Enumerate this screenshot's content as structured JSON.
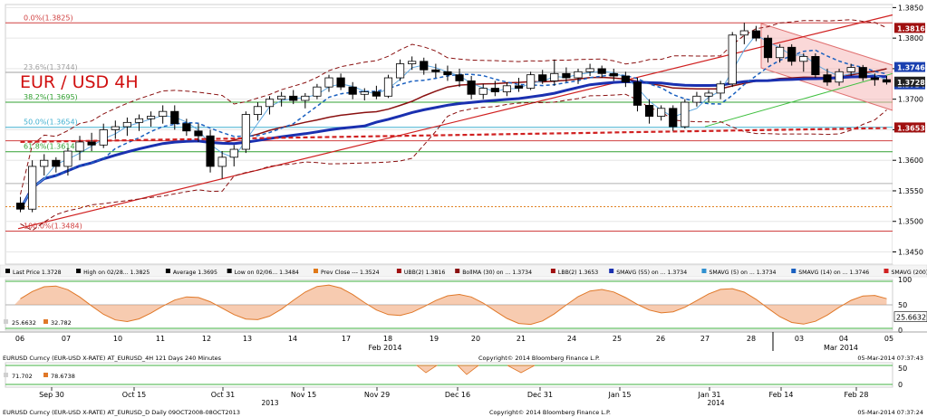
{
  "chart_data": {
    "type": "candlestick",
    "title": "EUR / USD 4H",
    "fib_levels": [
      {
        "label": "0.0%(1.3825)",
        "value": 1.3825,
        "color": "#d04040"
      },
      {
        "label": "23.6%(1.3744)",
        "value": 1.3744,
        "color": "#a0a0a0"
      },
      {
        "label": "38.2%(1.3695)",
        "value": 1.3695,
        "color": "#30a030"
      },
      {
        "label": "50.0%(1.3654)",
        "value": 1.3654,
        "color": "#40b0d0"
      },
      {
        "label": "61.8%(1.3614)",
        "value": 1.3614,
        "color": "#30a030"
      },
      {
        "label": "100.0%(1.3484)",
        "value": 1.3484,
        "color": "#d04040"
      }
    ],
    "y_ticks": [
      "1.3850",
      "1.3800",
      "1.3750",
      "1.3700",
      "1.3650",
      "1.3600",
      "1.3550",
      "1.3500",
      "1.3450"
    ],
    "ylim": [
      1.343,
      1.3855
    ],
    "price_tags": [
      {
        "label": "1.3816",
        "value": 1.3816,
        "bg": "#a01010"
      },
      {
        "label": "1.3746",
        "value": 1.3746,
        "bg": "#1a40b0"
      },
      {
        "label": "1.3734",
        "value": 1.3734,
        "bg": "#1a40b0"
      },
      {
        "label": "1.3728",
        "value": 1.3728,
        "bg": "#222222"
      },
      {
        "label": "1.3653",
        "value": 1.3653,
        "bg": "#a01010"
      }
    ],
    "x_day_labels": [
      "06",
      "07",
      "10",
      "11",
      "12",
      "13",
      "14",
      "17",
      "18",
      "19",
      "20",
      "21",
      "24",
      "25",
      "26",
      "27",
      "28",
      "03",
      "04",
      "05"
    ],
    "x_month_labels": [
      "Feb 2014",
      "Mar 2014"
    ],
    "candles": [
      [
        1.353,
        1.354,
        1.3515,
        1.352
      ],
      [
        1.352,
        1.36,
        1.3515,
        1.359
      ],
      [
        1.359,
        1.361,
        1.3575,
        1.36
      ],
      [
        1.36,
        1.3605,
        1.358,
        1.359
      ],
      [
        1.359,
        1.362,
        1.3575,
        1.3615
      ],
      [
        1.3615,
        1.364,
        1.36,
        1.363
      ],
      [
        1.363,
        1.3645,
        1.3615,
        1.3625
      ],
      [
        1.3625,
        1.366,
        1.362,
        1.365
      ],
      [
        1.365,
        1.3665,
        1.3635,
        1.3655
      ],
      [
        1.3655,
        1.367,
        1.364,
        1.3662
      ],
      [
        1.3662,
        1.3675,
        1.3648,
        1.3668
      ],
      [
        1.3668,
        1.368,
        1.3655,
        1.3672
      ],
      [
        1.3672,
        1.369,
        1.366,
        1.368
      ],
      [
        1.368,
        1.369,
        1.365,
        1.366
      ],
      [
        1.366,
        1.3668,
        1.364,
        1.3648
      ],
      [
        1.3648,
        1.366,
        1.363,
        1.364
      ],
      [
        1.364,
        1.365,
        1.358,
        1.359
      ],
      [
        1.359,
        1.3615,
        1.357,
        1.3605
      ],
      [
        1.3605,
        1.3625,
        1.359,
        1.3618
      ],
      [
        1.3618,
        1.368,
        1.3612,
        1.3675
      ],
      [
        1.3675,
        1.3695,
        1.3665,
        1.3688
      ],
      [
        1.3688,
        1.3705,
        1.3675,
        1.37
      ],
      [
        1.37,
        1.3712,
        1.3688,
        1.3705
      ],
      [
        1.3705,
        1.3715,
        1.3692,
        1.3698
      ],
      [
        1.3698,
        1.371,
        1.3685,
        1.3705
      ],
      [
        1.3705,
        1.3725,
        1.37,
        1.372
      ],
      [
        1.372,
        1.374,
        1.3712,
        1.3735
      ],
      [
        1.3735,
        1.3742,
        1.3715,
        1.372
      ],
      [
        1.372,
        1.3728,
        1.37,
        1.3708
      ],
      [
        1.3708,
        1.3718,
        1.3698,
        1.3712
      ],
      [
        1.3712,
        1.3722,
        1.37,
        1.3705
      ],
      [
        1.3705,
        1.374,
        1.3702,
        1.3735
      ],
      [
        1.3735,
        1.3765,
        1.373,
        1.3758
      ],
      [
        1.3758,
        1.377,
        1.3748,
        1.3762
      ],
      [
        1.3762,
        1.3768,
        1.374,
        1.3748
      ],
      [
        1.3748,
        1.3758,
        1.3735,
        1.3745
      ],
      [
        1.3745,
        1.3755,
        1.373,
        1.374
      ],
      [
        1.374,
        1.375,
        1.372,
        1.373
      ],
      [
        1.373,
        1.3738,
        1.37,
        1.3708
      ],
      [
        1.3708,
        1.3725,
        1.37,
        1.3718
      ],
      [
        1.3718,
        1.373,
        1.3705,
        1.3712
      ],
      [
        1.3712,
        1.3728,
        1.3705,
        1.3722
      ],
      [
        1.3722,
        1.3735,
        1.3712,
        1.3718
      ],
      [
        1.3718,
        1.3745,
        1.3715,
        1.374
      ],
      [
        1.374,
        1.3748,
        1.3725,
        1.373
      ],
      [
        1.373,
        1.3765,
        1.3722,
        1.3742
      ],
      [
        1.3742,
        1.3752,
        1.3728,
        1.3735
      ],
      [
        1.3735,
        1.375,
        1.3725,
        1.3745
      ],
      [
        1.3745,
        1.3758,
        1.3738,
        1.375
      ],
      [
        1.375,
        1.3755,
        1.3735,
        1.3742
      ],
      [
        1.3742,
        1.375,
        1.373,
        1.3738
      ],
      [
        1.3738,
        1.3745,
        1.372,
        1.3728
      ],
      [
        1.3728,
        1.3735,
        1.368,
        1.369
      ],
      [
        1.369,
        1.37,
        1.366,
        1.3672
      ],
      [
        1.3672,
        1.369,
        1.3665,
        1.3685
      ],
      [
        1.3685,
        1.369,
        1.3648,
        1.3655
      ],
      [
        1.3655,
        1.37,
        1.3652,
        1.3695
      ],
      [
        1.3695,
        1.3712,
        1.3688,
        1.3705
      ],
      [
        1.3705,
        1.3715,
        1.3695,
        1.371
      ],
      [
        1.371,
        1.373,
        1.37,
        1.3725
      ],
      [
        1.3725,
        1.381,
        1.372,
        1.3805
      ],
      [
        1.3805,
        1.3825,
        1.379,
        1.3812
      ],
      [
        1.3812,
        1.382,
        1.3795,
        1.38
      ],
      [
        1.38,
        1.3805,
        1.376,
        1.3768
      ],
      [
        1.3768,
        1.379,
        1.376,
        1.3785
      ],
      [
        1.3785,
        1.379,
        1.3755,
        1.3762
      ],
      [
        1.3762,
        1.3775,
        1.3745,
        1.377
      ],
      [
        1.377,
        1.3775,
        1.3735,
        1.374
      ],
      [
        1.374,
        1.375,
        1.3722,
        1.3728
      ],
      [
        1.3728,
        1.375,
        1.3722,
        1.3745
      ],
      [
        1.3745,
        1.3758,
        1.3738,
        1.3752
      ],
      [
        1.3752,
        1.3756,
        1.373,
        1.3735
      ],
      [
        1.3735,
        1.3742,
        1.3722,
        1.3732
      ],
      [
        1.3732,
        1.3738,
        1.3724,
        1.3728
      ]
    ],
    "legend": [
      {
        "text": "Last Price  1.3728",
        "color": "#000000"
      },
      {
        "text": "High on 02/28...  1.3825",
        "color": "#000000"
      },
      {
        "text": "Average  1.3695",
        "color": "#000000"
      },
      {
        "text": "Low on 02/06...  1.3484",
        "color": "#000000"
      },
      {
        "text": "Prev Close ---  1.3524",
        "color": "#e07818"
      },
      {
        "text": "UBB(2)  1.3816",
        "color": "#a01010"
      },
      {
        "text": "BollMA (30) on ...  1.3734",
        "color": "#8a1010"
      },
      {
        "text": "LBB(2)  1.3653",
        "color": "#a01010"
      },
      {
        "text": "SMAVG (55) on ...  1.3734",
        "color": "#1a30b0"
      },
      {
        "text": "SMAVG (5) on ...  1.3734",
        "color": "#3090d0"
      },
      {
        "text": "SMAVG (14) on ...  1.3746",
        "color": "#1a60c0"
      },
      {
        "text": "SMAVG (200) ...  1.3653",
        "color": "#d02020"
      }
    ],
    "osc_ticks": [
      "100",
      "50",
      "0"
    ],
    "osc_values": [
      "25.6632",
      "32.782"
    ],
    "osc_tag": "25.6632",
    "footer1": {
      "left": "EURUSD Curncy (EUR-USD X-RATE) AT_EURUSD_4H 121 Days 240 Minutes",
      "center": "Copyright© 2014 Bloomberg Finance L.P.",
      "right": "05-Mar-2014 07:37:43"
    },
    "mini_values": [
      "71.702",
      "78.6738"
    ],
    "mini_ticks": [
      "50",
      "0"
    ],
    "mini_x_labels": [
      "Sep 30",
      "Oct 15",
      "Oct 31",
      "Nov 15",
      "Nov 29",
      "Dec 16",
      "Dec 31",
      "Jan 15",
      "Jan 31",
      "Feb 14",
      "Feb 28"
    ],
    "mini_years": [
      "2013",
      "2014"
    ],
    "footer2": {
      "left": "EURUSD Curncy (EUR-USD X-RATE) AT_EURUSD_D  Daily 09OCT2008-08OCT2013",
      "center": "Copyright© 2014 Bloomberg Finance L.P.",
      "right": "05-Mar-2014 07:37:24"
    }
  }
}
